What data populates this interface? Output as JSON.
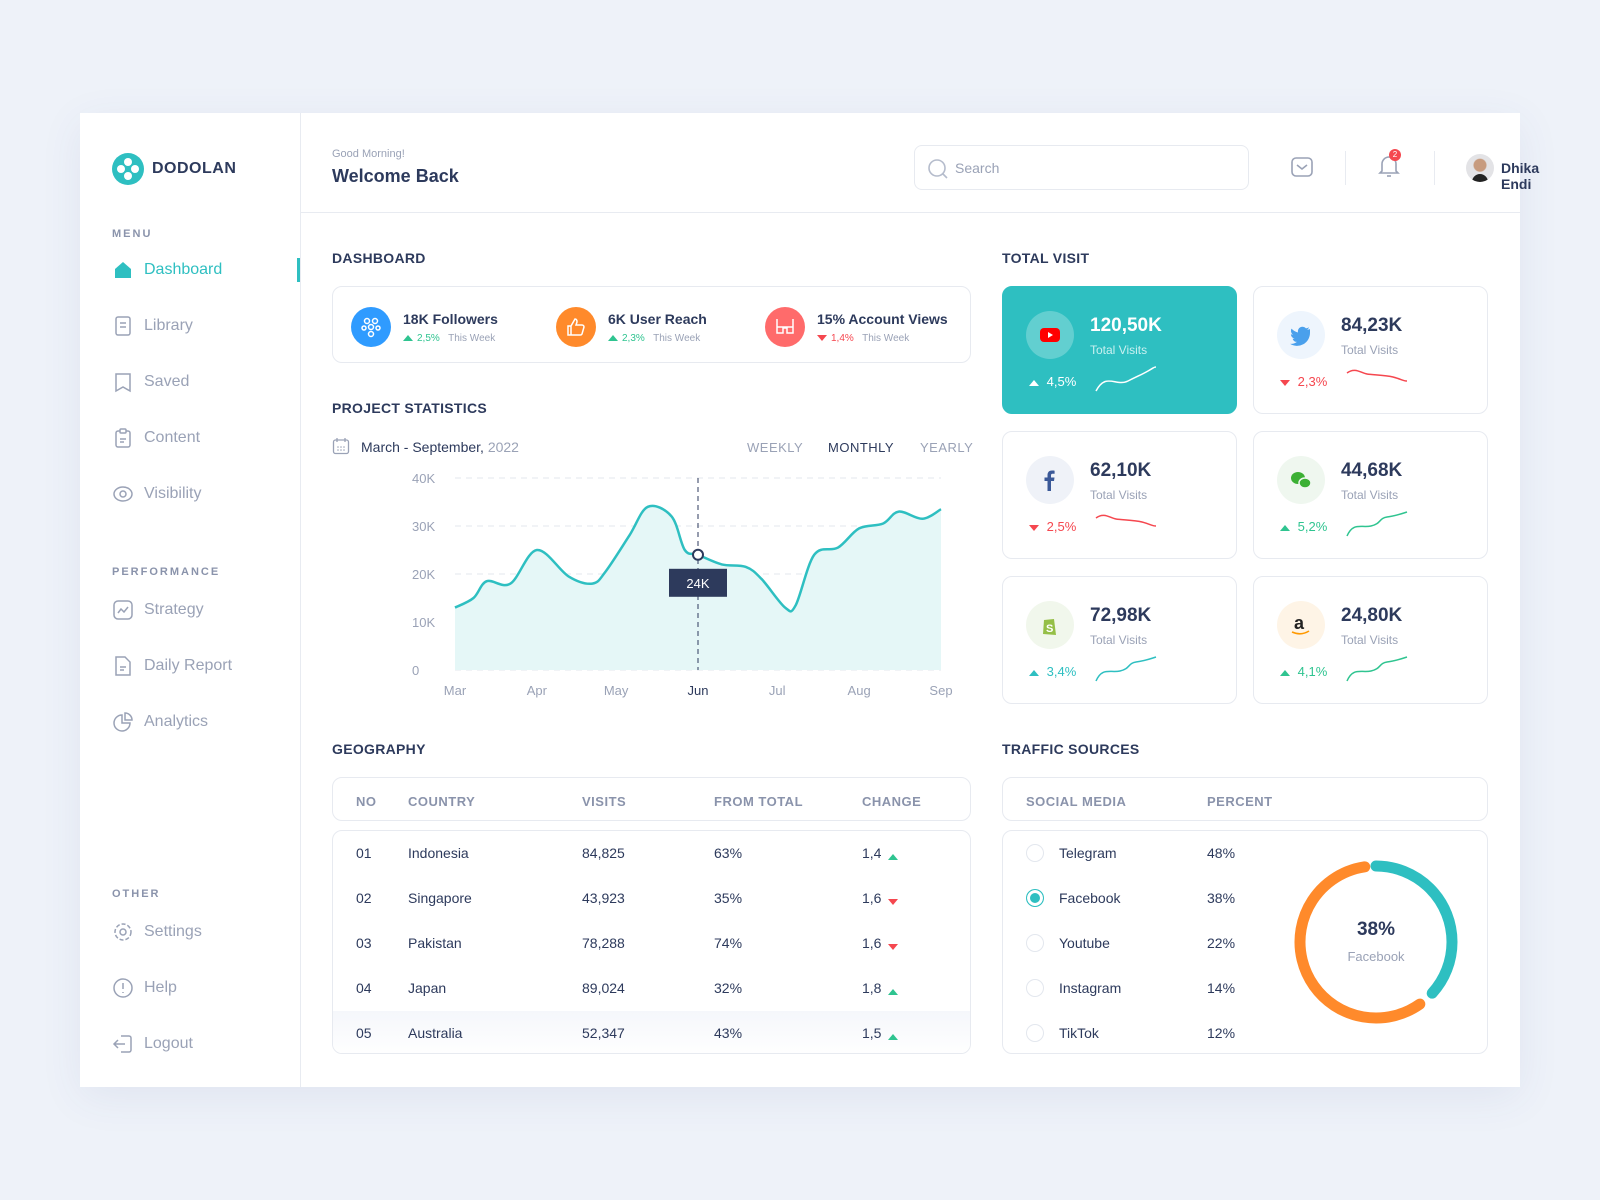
{
  "brand": {
    "name": "DODOLAN",
    "accent": "#2ebfc1"
  },
  "sidebar": {
    "menu_label": "MENU",
    "menu": [
      {
        "label": "Dashboard",
        "icon": "home-icon",
        "active": true
      },
      {
        "label": "Library",
        "icon": "book-icon"
      },
      {
        "label": "Saved",
        "icon": "bookmark-icon"
      },
      {
        "label": "Content",
        "icon": "clipboard-icon"
      },
      {
        "label": "Visibility",
        "icon": "eye-icon"
      }
    ],
    "performance_label": "PERFORMANCE",
    "performance": [
      {
        "label": "Strategy",
        "icon": "chart-line-icon"
      },
      {
        "label": "Daily Report",
        "icon": "document-icon"
      },
      {
        "label": "Analytics",
        "icon": "pie-chart-icon"
      }
    ],
    "other_label": "OTHER",
    "other": [
      {
        "label": "Settings",
        "icon": "gear-icon"
      },
      {
        "label": "Help",
        "icon": "alert-circle-icon"
      },
      {
        "label": "Logout",
        "icon": "logout-icon"
      }
    ]
  },
  "header": {
    "greeting": "Good Morning!",
    "title": "Welcome Back",
    "search_placeholder": "Search",
    "notification_count": "2",
    "user_name": "Dhika Endi"
  },
  "dashboard": {
    "title": "DASHBOARD",
    "stats": [
      {
        "title": "18K Followers",
        "change": "2,5%",
        "trend": "up",
        "period": "This Week",
        "icon": "followers-icon",
        "color": "#2f9bff"
      },
      {
        "title": "6K User Reach",
        "change": "2,3%",
        "trend": "up",
        "period": "This Week",
        "icon": "thumbs-up-icon",
        "color": "#ff8a2b"
      },
      {
        "title": "15% Account Views",
        "change": "1,4%",
        "trend": "down",
        "period": "This Week",
        "icon": "glasses-icon",
        "color": "#ff6b6b"
      }
    ]
  },
  "project": {
    "title": "PROJECT STATISTICS",
    "date_range": "March - September,",
    "year": "2022",
    "tabs": [
      "WEEKLY",
      "MONTHLY",
      "YEARLY"
    ],
    "active_tab": "MONTHLY",
    "tooltip": "24K"
  },
  "chart_data": {
    "type": "area",
    "x_tick_labels": [
      "Mar",
      "Apr",
      "May",
      "Jun",
      "Jul",
      "Aug",
      "Sep"
    ],
    "highlight_x": "Jun",
    "y_tick_labels": [
      "0",
      "10K",
      "20K",
      "30K",
      "40K"
    ],
    "ylim": [
      0,
      40000
    ],
    "grid": true,
    "color": "#2ebfc1",
    "points": [
      [
        "2022-03-01",
        13000
      ],
      [
        "2022-03-08",
        15000
      ],
      [
        "2022-03-13",
        18500
      ],
      [
        "2022-03-22",
        18000
      ],
      [
        "2022-04-01",
        25000
      ],
      [
        "2022-04-13",
        19500
      ],
      [
        "2022-04-22",
        18000
      ],
      [
        "2022-04-27",
        20500
      ],
      [
        "2022-05-06",
        28000
      ],
      [
        "2022-05-13",
        34000
      ],
      [
        "2022-05-22",
        32000
      ],
      [
        "2022-05-27",
        25000
      ],
      [
        "2022-06-01",
        24000
      ],
      [
        "2022-06-10",
        22000
      ],
      [
        "2022-06-19",
        21500
      ],
      [
        "2022-06-25",
        19000
      ],
      [
        "2022-07-04",
        13000
      ],
      [
        "2022-07-08",
        13500
      ],
      [
        "2022-07-15",
        24000
      ],
      [
        "2022-07-24",
        25500
      ],
      [
        "2022-08-01",
        29500
      ],
      [
        "2022-08-10",
        30500
      ],
      [
        "2022-08-16",
        33000
      ],
      [
        "2022-08-25",
        31500
      ],
      [
        "2022-09-01",
        33500
      ]
    ]
  },
  "geography": {
    "title": "GEOGRAPHY",
    "columns": [
      "NO",
      "COUNTRY",
      "VISITS",
      "FROM TOTAL",
      "CHANGE"
    ],
    "rows": [
      [
        "01",
        "Indonesia",
        "84,825",
        "63%",
        "1,4",
        "up"
      ],
      [
        "02",
        "Singapore",
        "43,923",
        "35%",
        "1,6",
        "down"
      ],
      [
        "03",
        "Pakistan",
        "78,288",
        "74%",
        "1,6",
        "down"
      ],
      [
        "04",
        "Japan",
        "89,024",
        "32%",
        "1,8",
        "up"
      ],
      [
        "05",
        "Australia",
        "52,347",
        "43%",
        "1,5",
        "up"
      ]
    ]
  },
  "total_visit": {
    "title": "TOTAL VISIT",
    "cards": [
      {
        "platform": "youtube",
        "icon": "youtube-icon",
        "value": "120,50K",
        "label": "Total Visits",
        "change": "4,5%",
        "trend": "up",
        "highlighted": true
      },
      {
        "platform": "twitter",
        "icon": "twitter-icon",
        "value": "84,23K",
        "label": "Total Visits",
        "change": "2,3%",
        "trend": "down"
      },
      {
        "platform": "facebook",
        "icon": "facebook-icon",
        "value": "62,10K",
        "label": "Total Visits",
        "change": "2,5%",
        "trend": "down"
      },
      {
        "platform": "wechat",
        "icon": "wechat-icon",
        "value": "44,68K",
        "label": "Total Visits",
        "change": "5,2%",
        "trend": "up"
      },
      {
        "platform": "shopify",
        "icon": "shopify-icon",
        "value": "72,98K",
        "label": "Total Visits",
        "change": "3,4%",
        "trend": "up"
      },
      {
        "platform": "amazon",
        "icon": "amazon-icon",
        "value": "24,80K",
        "label": "Total Visits",
        "change": "4,1%",
        "trend": "up"
      }
    ]
  },
  "traffic": {
    "title": "TRAFFIC SOURCES",
    "columns": [
      "SOCIAL MEDIA",
      "PERCENT"
    ],
    "rows": [
      [
        "Telegram",
        "48%"
      ],
      [
        "Facebook",
        "38%"
      ],
      [
        "Youtube",
        "22%"
      ],
      [
        "Instagram",
        "14%"
      ],
      [
        "TikTok",
        "12%"
      ]
    ],
    "selected": "Facebook",
    "donut_value": "38%",
    "donut_label": "Facebook",
    "donut_percent": 38,
    "colors": {
      "selected": "#2ebfc1",
      "rest": "#ff8a2b"
    }
  }
}
